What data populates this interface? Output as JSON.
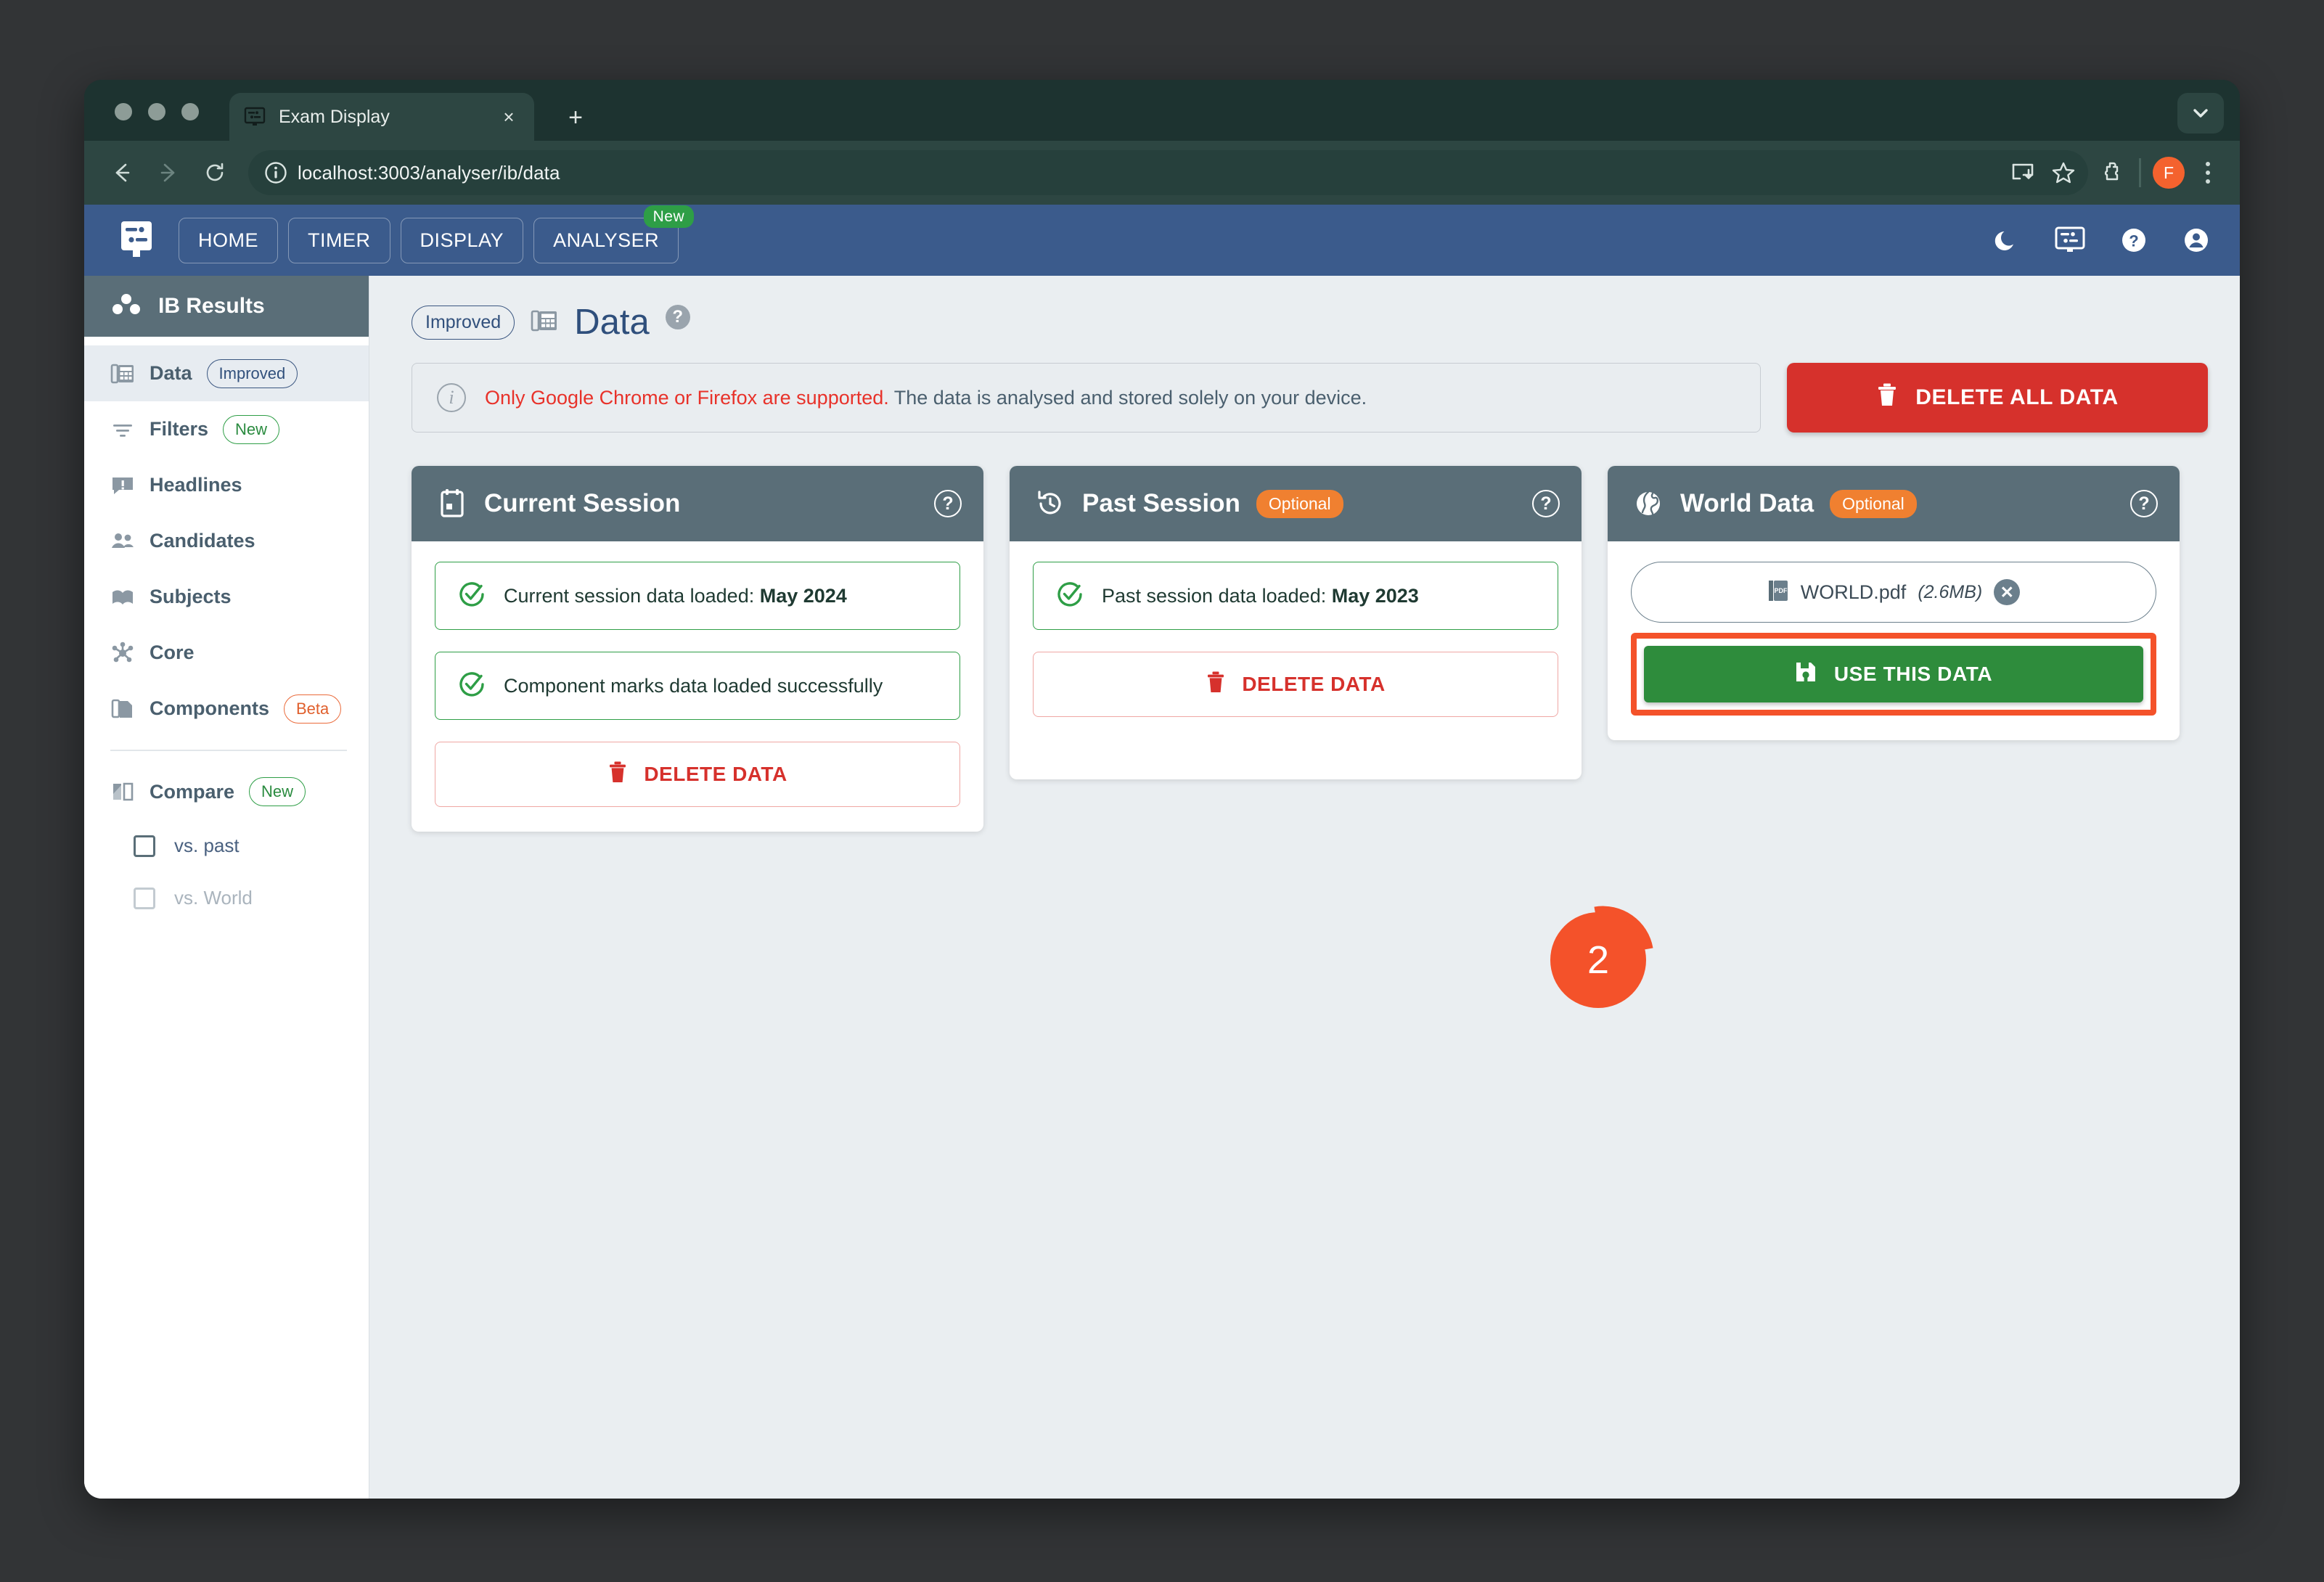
{
  "browser": {
    "tab_title": "Exam Display",
    "tab_favicon_name": "exam-display-favicon",
    "close_label": "×",
    "new_tab_label": "+",
    "url": "localhost:3003/analyser/ib/data",
    "profile_initial": "F",
    "icons": {
      "back": "back-arrow-icon",
      "forward": "forward-arrow-icon",
      "reload": "reload-icon",
      "site_info": "site-info-icon",
      "install": "install-app-icon",
      "bookmark": "bookmark-star-icon",
      "extensions": "extensions-puzzle-icon",
      "menu": "kebab-menu-icon",
      "window_chevron": "window-chevron-down-icon"
    }
  },
  "appbar": {
    "logo_name": "exam-display-logo",
    "nav": [
      {
        "label": "HOME",
        "badge": null
      },
      {
        "label": "TIMER",
        "badge": null
      },
      {
        "label": "DISPLAY",
        "badge": null
      },
      {
        "label": "ANALYSER",
        "badge": "New"
      }
    ],
    "icons": [
      {
        "name": "dark-mode-moon-icon"
      },
      {
        "name": "display-screen-icon"
      },
      {
        "name": "help-question-icon"
      },
      {
        "name": "account-avatar-icon"
      }
    ]
  },
  "sidebar": {
    "header": {
      "label": "IB Results",
      "icon": "results-dots-icon"
    },
    "items": [
      {
        "label": "Data",
        "icon": "data-table-icon",
        "chip": "Improved",
        "chip_type": "improved",
        "active": true
      },
      {
        "label": "Filters",
        "icon": "filter-icon",
        "chip": "New",
        "chip_type": "new",
        "active": false
      },
      {
        "label": "Headlines",
        "icon": "headlines-icon",
        "chip": null,
        "chip_type": null,
        "active": false
      },
      {
        "label": "Candidates",
        "icon": "candidates-people-icon",
        "chip": null,
        "chip_type": null,
        "active": false
      },
      {
        "label": "Subjects",
        "icon": "subjects-book-icon",
        "chip": null,
        "chip_type": null,
        "active": false
      },
      {
        "label": "Core",
        "icon": "core-network-icon",
        "chip": null,
        "chip_type": null,
        "active": false
      },
      {
        "label": "Components",
        "icon": "components-copy-icon",
        "chip": "Beta",
        "chip_type": "beta",
        "active": false
      }
    ],
    "compare": {
      "label": "Compare",
      "icon": "compare-split-icon",
      "chip": "New",
      "options": [
        {
          "label": "vs. past",
          "checked": false,
          "disabled": false
        },
        {
          "label": "vs. World",
          "checked": false,
          "disabled": true
        }
      ]
    }
  },
  "page": {
    "chip": "Improved",
    "title": "Data",
    "title_icon": "data-table-icon",
    "help_icon": "help-question-icon",
    "alert": {
      "icon": "info-icon",
      "warning": "Only Google Chrome or Firefox are supported.",
      "text": " The data is analysed and stored solely on your device."
    },
    "delete_all_button": {
      "label": "DELETE ALL DATA",
      "icon": "trash-icon",
      "color": "#d6312c"
    }
  },
  "cards": [
    {
      "id": "current-session",
      "title": "Current Session",
      "icon": "calendar-icon",
      "badge": null,
      "help_icon": "help-question-icon",
      "statuses": [
        {
          "text": "Current session data loaded: ",
          "strong": "May 2024",
          "icon": "check-circle-icon"
        },
        {
          "text": "Component marks data loaded successfully",
          "strong": "",
          "icon": "check-circle-icon"
        }
      ],
      "delete_button": {
        "label": "DELETE DATA",
        "icon": "trash-icon"
      }
    },
    {
      "id": "past-session",
      "title": "Past Session",
      "icon": "history-clock-icon",
      "badge": "Optional",
      "help_icon": "help-question-icon",
      "statuses": [
        {
          "text": "Past session data loaded: ",
          "strong": "May 2023",
          "icon": "check-circle-icon"
        }
      ],
      "delete_button": {
        "label": "DELETE DATA",
        "icon": "trash-icon"
      }
    },
    {
      "id": "world-data",
      "title": "World Data",
      "icon": "globe-icon",
      "badge": "Optional",
      "help_icon": "help-question-icon",
      "file": {
        "name": "WORLD.pdf",
        "size": "(2.6MB)",
        "icon": "pdf-file-icon",
        "remove_label": "✕"
      },
      "use_button": {
        "label": "USE THIS DATA",
        "icon": "save-floppy-icon",
        "color": "#2e8c3c"
      }
    }
  ],
  "callout": {
    "number": "2",
    "color": "#f4522a"
  }
}
